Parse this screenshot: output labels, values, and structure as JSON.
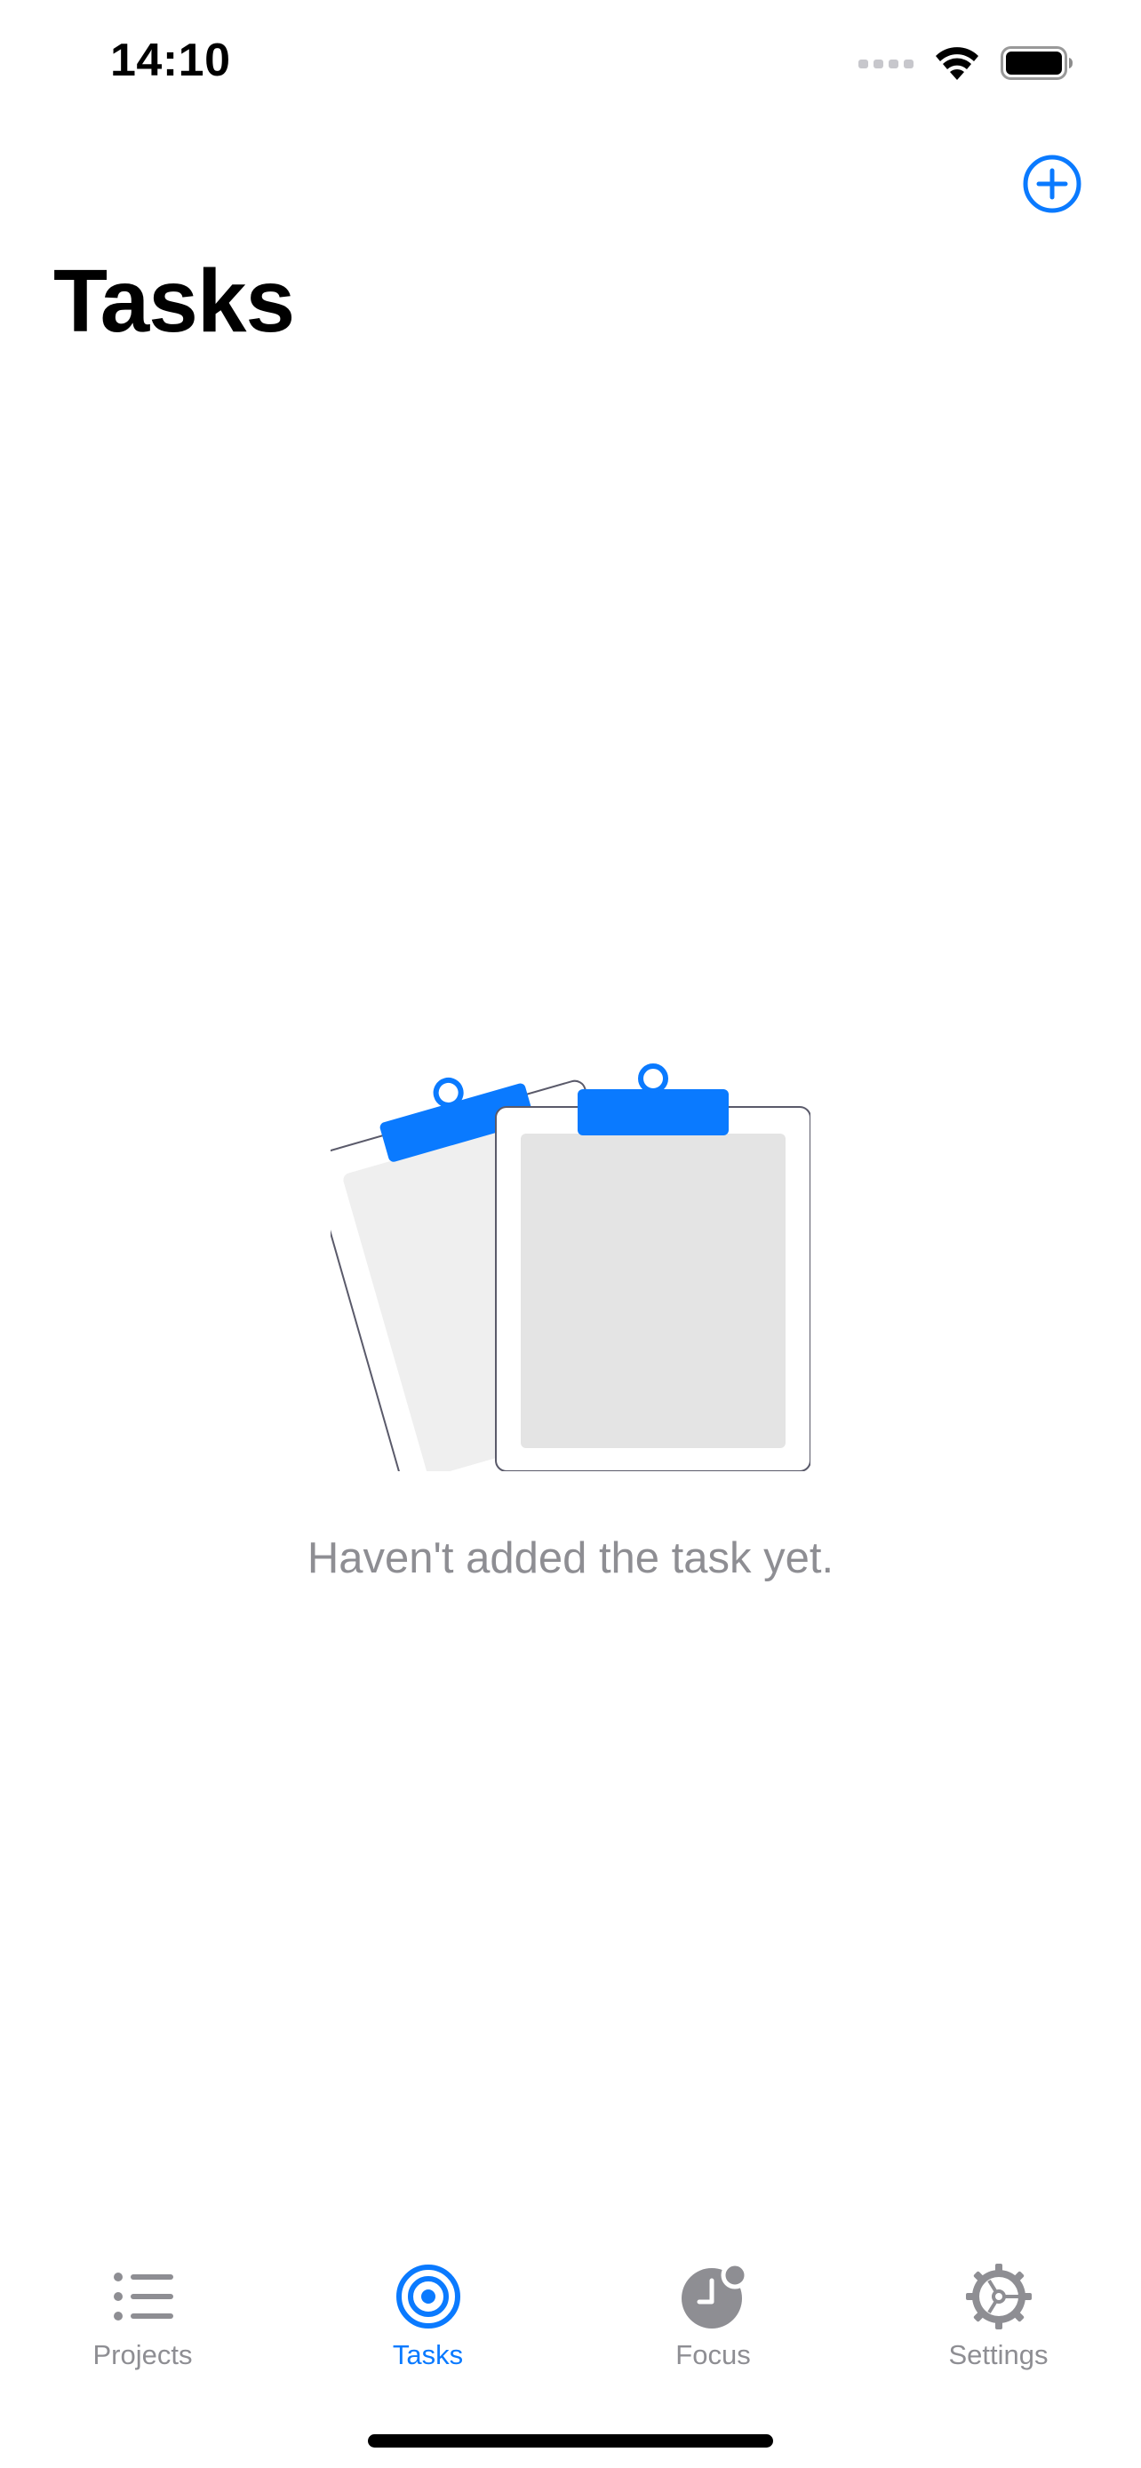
{
  "status_bar": {
    "time": "14:10"
  },
  "header": {
    "title": "Tasks",
    "add_icon": "plus-circle-icon"
  },
  "empty_state": {
    "illustration": "clipboards-illustration",
    "message": "Haven't added the task yet."
  },
  "tab_bar": {
    "tabs": [
      {
        "label": "Projects",
        "icon": "list-icon",
        "active": false
      },
      {
        "label": "Tasks",
        "icon": "target-icon",
        "active": true
      },
      {
        "label": "Focus",
        "icon": "clock-icon",
        "active": false
      },
      {
        "label": "Settings",
        "icon": "gear-icon",
        "active": false
      }
    ]
  },
  "colors": {
    "accent": "#0a7aff",
    "inactive": "#8e8e93",
    "illustration_light": "#efefef",
    "illustration_mid": "#e4e4e4"
  }
}
